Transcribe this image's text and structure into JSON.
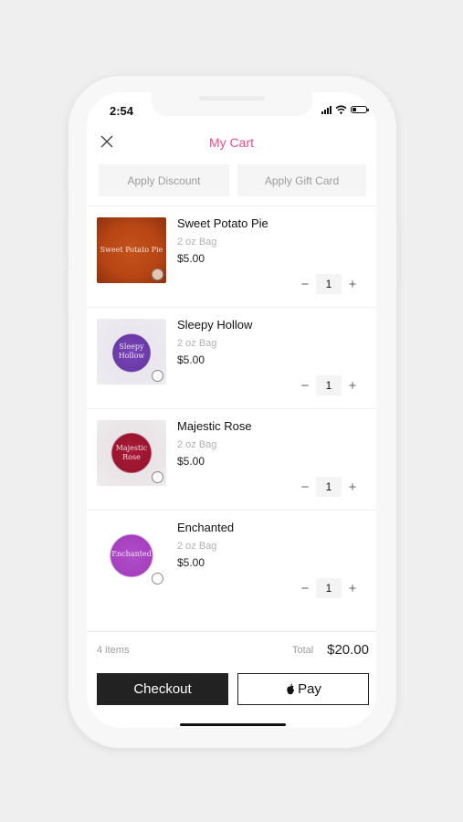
{
  "status_bar": {
    "time": "2:54"
  },
  "header": {
    "title": "My Cart"
  },
  "promo": {
    "discount_label": "Apply Discount",
    "gift_card_label": "Apply Gift Card"
  },
  "cart": {
    "items": [
      {
        "name": "Sweet Potato Pie",
        "variant": "2 oz Bag",
        "price": "$5.00",
        "qty": "1",
        "thumb_text": "Sweet Potato Pie",
        "thumb_color": "#b84614"
      },
      {
        "name": "Sleepy Hollow",
        "variant": "2 oz Bag",
        "price": "$5.00",
        "qty": "1",
        "thumb_text": "Sleepy Hollow",
        "thumb_color": "#6a3aa6"
      },
      {
        "name": "Majestic Rose",
        "variant": "2 oz Bag",
        "price": "$5.00",
        "qty": "1",
        "thumb_text": "Majestic Rose",
        "thumb_color": "#9b1530"
      },
      {
        "name": "Enchanted",
        "variant": "2 oz Bag",
        "price": "$5.00",
        "qty": "1",
        "thumb_text": "Enchanted",
        "thumb_color": "#a63fbf"
      }
    ]
  },
  "footer": {
    "item_count": "4 items",
    "total_label": "Total",
    "total_value": "$20.00",
    "checkout_label": "Checkout",
    "apple_pay_label": "Pay"
  },
  "colors": {
    "accent": "#e84d8a",
    "button_dark": "#222222"
  },
  "icons": {
    "close": "close-icon",
    "minus": "minus-icon",
    "plus": "plus-icon",
    "apple": "apple-logo-icon"
  }
}
